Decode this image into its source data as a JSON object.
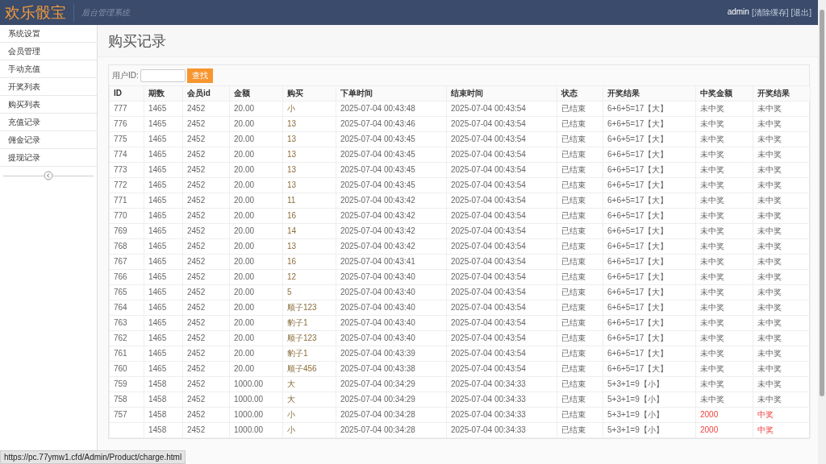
{
  "header": {
    "logo": "欢乐骰宝",
    "subtitle": "后台管理系统",
    "user": "admin",
    "links": [
      "[清除缓存]",
      "[退出]"
    ]
  },
  "sidebar": {
    "items": [
      {
        "label": "系统设置"
      },
      {
        "label": "会员管理"
      },
      {
        "label": "手动充值"
      },
      {
        "label": "开奖列表"
      },
      {
        "label": "购买列表"
      },
      {
        "label": "充值记录"
      },
      {
        "label": "佣金记录"
      },
      {
        "label": "提现记录"
      }
    ]
  },
  "page_title": "购买记录",
  "search": {
    "label": "用户ID:",
    "button": "查找"
  },
  "table": {
    "columns": [
      "ID",
      "期数",
      "会员id",
      "金额",
      "购买",
      "下单时间",
      "结束时间",
      "状态",
      "开奖结果",
      "中奖金额",
      "开奖结果"
    ],
    "rows": [
      {
        "id": "777",
        "period": "1465",
        "member": "2452",
        "amount": "20.00",
        "bet": "小",
        "order_time": "2025-07-04 00:43:48",
        "end_time": "2025-07-04 00:43:54",
        "status": "已结束",
        "result": "6+6+5=17【大】",
        "prize": "未中奖",
        "outcome": "未中奖",
        "won": false
      },
      {
        "id": "776",
        "period": "1465",
        "member": "2452",
        "amount": "20.00",
        "bet": "13",
        "order_time": "2025-07-04 00:43:46",
        "end_time": "2025-07-04 00:43:54",
        "status": "已结束",
        "result": "6+6+5=17【大】",
        "prize": "未中奖",
        "outcome": "未中奖",
        "won": false
      },
      {
        "id": "775",
        "period": "1465",
        "member": "2452",
        "amount": "20.00",
        "bet": "13",
        "order_time": "2025-07-04 00:43:45",
        "end_time": "2025-07-04 00:43:54",
        "status": "已结束",
        "result": "6+6+5=17【大】",
        "prize": "未中奖",
        "outcome": "未中奖",
        "won": false
      },
      {
        "id": "774",
        "period": "1465",
        "member": "2452",
        "amount": "20.00",
        "bet": "13",
        "order_time": "2025-07-04 00:43:45",
        "end_time": "2025-07-04 00:43:54",
        "status": "已结束",
        "result": "6+6+5=17【大】",
        "prize": "未中奖",
        "outcome": "未中奖",
        "won": false
      },
      {
        "id": "773",
        "period": "1465",
        "member": "2452",
        "amount": "20.00",
        "bet": "13",
        "order_time": "2025-07-04 00:43:45",
        "end_time": "2025-07-04 00:43:54",
        "status": "已结束",
        "result": "6+6+5=17【大】",
        "prize": "未中奖",
        "outcome": "未中奖",
        "won": false
      },
      {
        "id": "772",
        "period": "1465",
        "member": "2452",
        "amount": "20.00",
        "bet": "13",
        "order_time": "2025-07-04 00:43:45",
        "end_time": "2025-07-04 00:43:54",
        "status": "已结束",
        "result": "6+6+5=17【大】",
        "prize": "未中奖",
        "outcome": "未中奖",
        "won": false
      },
      {
        "id": "771",
        "period": "1465",
        "member": "2452",
        "amount": "20.00",
        "bet": "11",
        "order_time": "2025-07-04 00:43:42",
        "end_time": "2025-07-04 00:43:54",
        "status": "已结束",
        "result": "6+6+5=17【大】",
        "prize": "未中奖",
        "outcome": "未中奖",
        "won": false
      },
      {
        "id": "770",
        "period": "1465",
        "member": "2452",
        "amount": "20.00",
        "bet": "16",
        "order_time": "2025-07-04 00:43:42",
        "end_time": "2025-07-04 00:43:54",
        "status": "已结束",
        "result": "6+6+5=17【大】",
        "prize": "未中奖",
        "outcome": "未中奖",
        "won": false
      },
      {
        "id": "769",
        "period": "1465",
        "member": "2452",
        "amount": "20.00",
        "bet": "14",
        "order_time": "2025-07-04 00:43:42",
        "end_time": "2025-07-04 00:43:54",
        "status": "已结束",
        "result": "6+6+5=17【大】",
        "prize": "未中奖",
        "outcome": "未中奖",
        "won": false
      },
      {
        "id": "768",
        "period": "1465",
        "member": "2452",
        "amount": "20.00",
        "bet": "13",
        "order_time": "2025-07-04 00:43:42",
        "end_time": "2025-07-04 00:43:54",
        "status": "已结束",
        "result": "6+6+5=17【大】",
        "prize": "未中奖",
        "outcome": "未中奖",
        "won": false
      },
      {
        "id": "767",
        "period": "1465",
        "member": "2452",
        "amount": "20.00",
        "bet": "16",
        "order_time": "2025-07-04 00:43:41",
        "end_time": "2025-07-04 00:43:54",
        "status": "已结束",
        "result": "6+6+5=17【大】",
        "prize": "未中奖",
        "outcome": "未中奖",
        "won": false
      },
      {
        "id": "766",
        "period": "1465",
        "member": "2452",
        "amount": "20.00",
        "bet": "12",
        "order_time": "2025-07-04 00:43:40",
        "end_time": "2025-07-04 00:43:54",
        "status": "已结束",
        "result": "6+6+5=17【大】",
        "prize": "未中奖",
        "outcome": "未中奖",
        "won": false
      },
      {
        "id": "765",
        "period": "1465",
        "member": "2452",
        "amount": "20.00",
        "bet": "5",
        "order_time": "2025-07-04 00:43:40",
        "end_time": "2025-07-04 00:43:54",
        "status": "已结束",
        "result": "6+6+5=17【大】",
        "prize": "未中奖",
        "outcome": "未中奖",
        "won": false
      },
      {
        "id": "764",
        "period": "1465",
        "member": "2452",
        "amount": "20.00",
        "bet": "顺子123",
        "order_time": "2025-07-04 00:43:40",
        "end_time": "2025-07-04 00:43:54",
        "status": "已结束",
        "result": "6+6+5=17【大】",
        "prize": "未中奖",
        "outcome": "未中奖",
        "won": false
      },
      {
        "id": "763",
        "period": "1465",
        "member": "2452",
        "amount": "20.00",
        "bet": "豹子1",
        "order_time": "2025-07-04 00:43:40",
        "end_time": "2025-07-04 00:43:54",
        "status": "已结束",
        "result": "6+6+5=17【大】",
        "prize": "未中奖",
        "outcome": "未中奖",
        "won": false
      },
      {
        "id": "762",
        "period": "1465",
        "member": "2452",
        "amount": "20.00",
        "bet": "顺子123",
        "order_time": "2025-07-04 00:43:40",
        "end_time": "2025-07-04 00:43:54",
        "status": "已结束",
        "result": "6+6+5=17【大】",
        "prize": "未中奖",
        "outcome": "未中奖",
        "won": false
      },
      {
        "id": "761",
        "period": "1465",
        "member": "2452",
        "amount": "20.00",
        "bet": "豹子1",
        "order_time": "2025-07-04 00:43:39",
        "end_time": "2025-07-04 00:43:54",
        "status": "已结束",
        "result": "6+6+5=17【大】",
        "prize": "未中奖",
        "outcome": "未中奖",
        "won": false
      },
      {
        "id": "760",
        "period": "1465",
        "member": "2452",
        "amount": "20.00",
        "bet": "顺子456",
        "order_time": "2025-07-04 00:43:38",
        "end_time": "2025-07-04 00:43:54",
        "status": "已结束",
        "result": "6+6+5=17【大】",
        "prize": "未中奖",
        "outcome": "未中奖",
        "won": false
      },
      {
        "id": "759",
        "period": "1458",
        "member": "2452",
        "amount": "1000.00",
        "bet": "大",
        "order_time": "2025-07-04 00:34:29",
        "end_time": "2025-07-04 00:34:33",
        "status": "已结束",
        "result": "5+3+1=9【小】",
        "prize": "未中奖",
        "outcome": "未中奖",
        "won": false
      },
      {
        "id": "758",
        "period": "1458",
        "member": "2452",
        "amount": "1000.00",
        "bet": "大",
        "order_time": "2025-07-04 00:34:29",
        "end_time": "2025-07-04 00:34:33",
        "status": "已结束",
        "result": "5+3+1=9【小】",
        "prize": "未中奖",
        "outcome": "未中奖",
        "won": false
      },
      {
        "id": "757",
        "period": "1458",
        "member": "2452",
        "amount": "1000.00",
        "bet": "小",
        "order_time": "2025-07-04 00:34:28",
        "end_time": "2025-07-04 00:34:33",
        "status": "已结束",
        "result": "5+3+1=9【小】",
        "prize": "2000",
        "outcome": "中奖",
        "won": true
      },
      {
        "period": "1458",
        "member": "2452",
        "amount": "1000.00",
        "bet": "小",
        "order_time": "2025-07-04 00:34:28",
        "end_time": "2025-07-04 00:34:33",
        "status": "已结束",
        "result": "5+3+1=9【小】",
        "prize": "2000",
        "outcome": "中奖",
        "won": true
      }
    ]
  },
  "status_bar": {
    "url": "https://pc.77ymw1.cfd/Admin/Product/charge.html"
  }
}
